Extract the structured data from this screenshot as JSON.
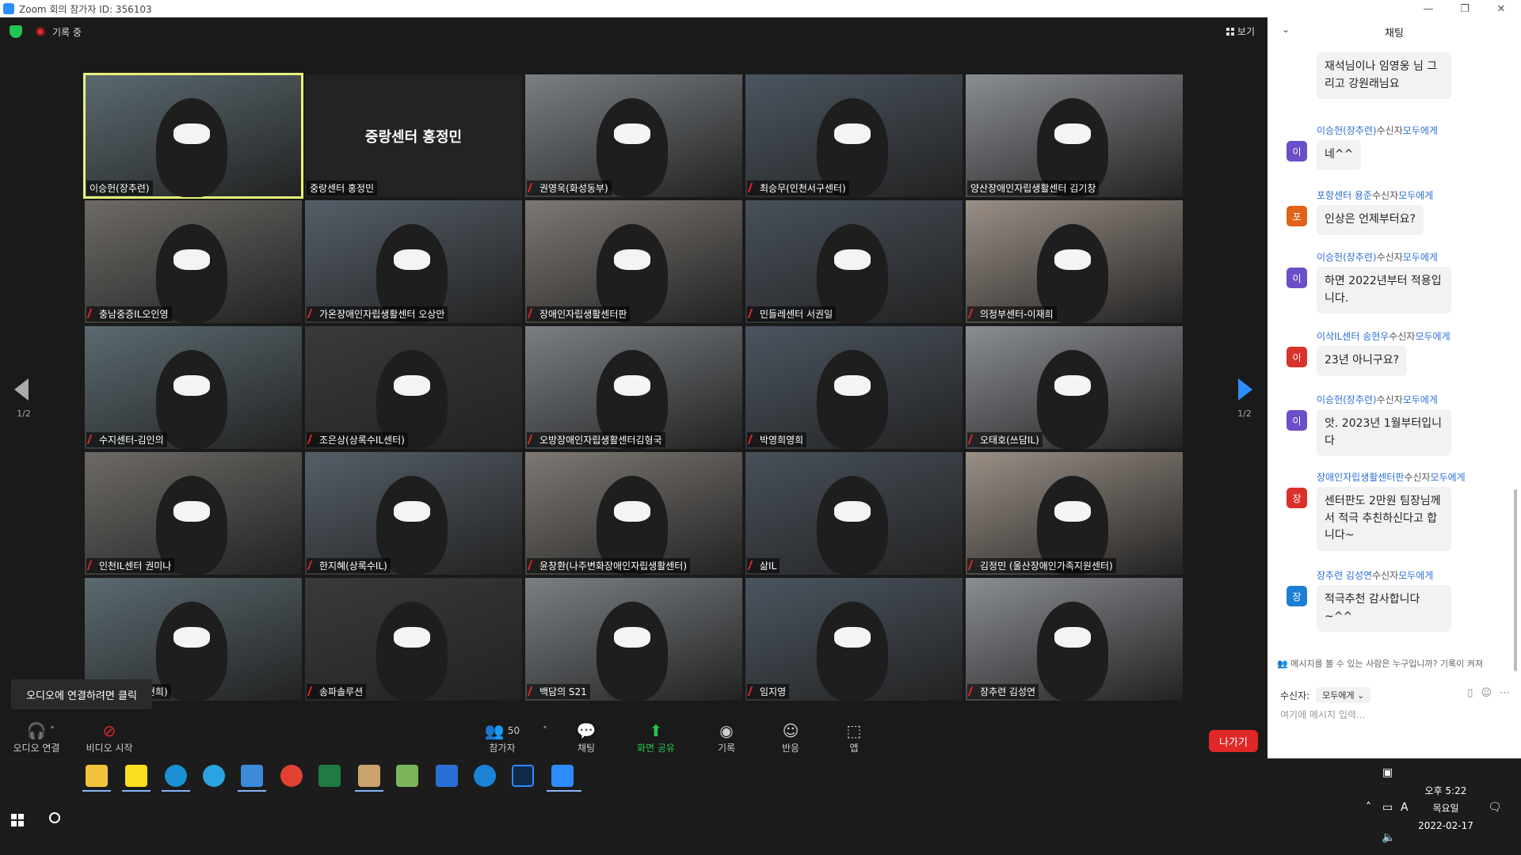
{
  "window": {
    "title": "Zoom 회의 참가자 ID: 356103"
  },
  "topbar": {
    "recording": "기록 중",
    "view_label": "보기"
  },
  "pager": {
    "left": "1/2",
    "right": "1/2"
  },
  "participants": [
    {
      "name": "이승헌(장추련)",
      "muted": false,
      "selected": true
    },
    {
      "name": "중랑센터 홍정민",
      "muted": false,
      "video_off": true,
      "big_label": "중랑센터 홍정민"
    },
    {
      "name": "권영욱(화성동부)",
      "muted": true
    },
    {
      "name": "최승무(인천서구센터)",
      "muted": true
    },
    {
      "name": "양산장애인자립생활센터 김기창",
      "muted": false
    },
    {
      "name": "충남중증IL오인영",
      "muted": true
    },
    {
      "name": "가온장애인자립생활센터 오상만",
      "muted": true
    },
    {
      "name": "장애인자립생활센터판",
      "muted": true
    },
    {
      "name": "민들레센터 서권일",
      "muted": true
    },
    {
      "name": "의정부센터-이재희",
      "muted": true
    },
    {
      "name": "수지센터-김인의",
      "muted": true
    },
    {
      "name": "조은상(상록수IL센터)",
      "muted": true
    },
    {
      "name": "오방장애인자립생활센터김형국",
      "muted": true
    },
    {
      "name": "박영희영희",
      "muted": true
    },
    {
      "name": "오태호(쓰담IL)",
      "muted": true
    },
    {
      "name": "인천IL센터 권미나",
      "muted": true
    },
    {
      "name": "한지혜(상록수IL)",
      "muted": true
    },
    {
      "name": "윤창환(나주변화장애인자립생활센터)",
      "muted": true
    },
    {
      "name": "삶IL",
      "muted": true
    },
    {
      "name": "김정민 (울산장애인가족지원센터)",
      "muted": true
    },
    {
      "name": "인권센터(안현희)",
      "muted": true
    },
    {
      "name": "송파솔루션",
      "muted": true
    },
    {
      "name": "백담의 S21",
      "muted": true
    },
    {
      "name": "임지영",
      "muted": true
    },
    {
      "name": "장추련 김성연",
      "muted": true
    }
  ],
  "tooltip": {
    "text": "오디오에 연결하려면 클릭"
  },
  "toolbar": {
    "audio": "오디오 연결",
    "video": "비디오 시작",
    "participants": "참가자",
    "participant_count": "50",
    "chat": "채팅",
    "share": "화면 공유",
    "record": "기록",
    "reactions": "반응",
    "apps": "앱",
    "end": "나가기"
  },
  "chat": {
    "title": "채팅",
    "first_bubble": "재석님이나 임영웅 님 그리고 강원래님요",
    "messages": [
      {
        "sender": "이승헌(장추련)",
        "to": "수신자",
        "target": "모두에게",
        "avatar": "이",
        "avatar_color": "#6b4fc8",
        "text": "네^^"
      },
      {
        "sender": "포항센터 용준",
        "to": "수신자",
        "target": "모두에게",
        "avatar": "포",
        "avatar_color": "#e0621b",
        "text": "인상은 언제부터요?"
      },
      {
        "sender": "이승헌(장추련)",
        "to": "수신자",
        "target": "모두에게",
        "avatar": "이",
        "avatar_color": "#6b4fc8",
        "text": "하면 2022년부터 적용입니다."
      },
      {
        "sender": "이삭IL센터 송현우",
        "to": "수신자",
        "target": "모두에게",
        "avatar": "이",
        "avatar_color": "#d9312b",
        "text": "23년 아니구요?"
      },
      {
        "sender": "이승헌(장추련)",
        "to": "수신자",
        "target": "모두에게",
        "avatar": "이",
        "avatar_color": "#6b4fc8",
        "text": "앗. 2023년 1월부터입니다"
      },
      {
        "sender": "장애인자립생활센터판",
        "to": "수신자",
        "target": "모두에게",
        "avatar": "장",
        "avatar_color": "#d9312b",
        "text": "센터판도 2만원 팀장님께서 적극 추친하신다고 합니다~"
      },
      {
        "sender": "장추련 김성연",
        "to": "수신자",
        "target": "모두에게",
        "avatar": "장",
        "avatar_color": "#1d7fd1",
        "text": "적극추천 감사합니다 ~^^"
      }
    ],
    "privacy_note": "메시지를 볼 수 있는 사람은 누구입니까? 기록이 켜져",
    "recipient_label": "수신자:",
    "recipient_value": "모두에게",
    "input_placeholder": "여기에 메시지 입력..."
  },
  "taskbar": {
    "time": "오후 5:22",
    "weekday": "목요일",
    "date": "2022-02-17",
    "lang": "A"
  }
}
